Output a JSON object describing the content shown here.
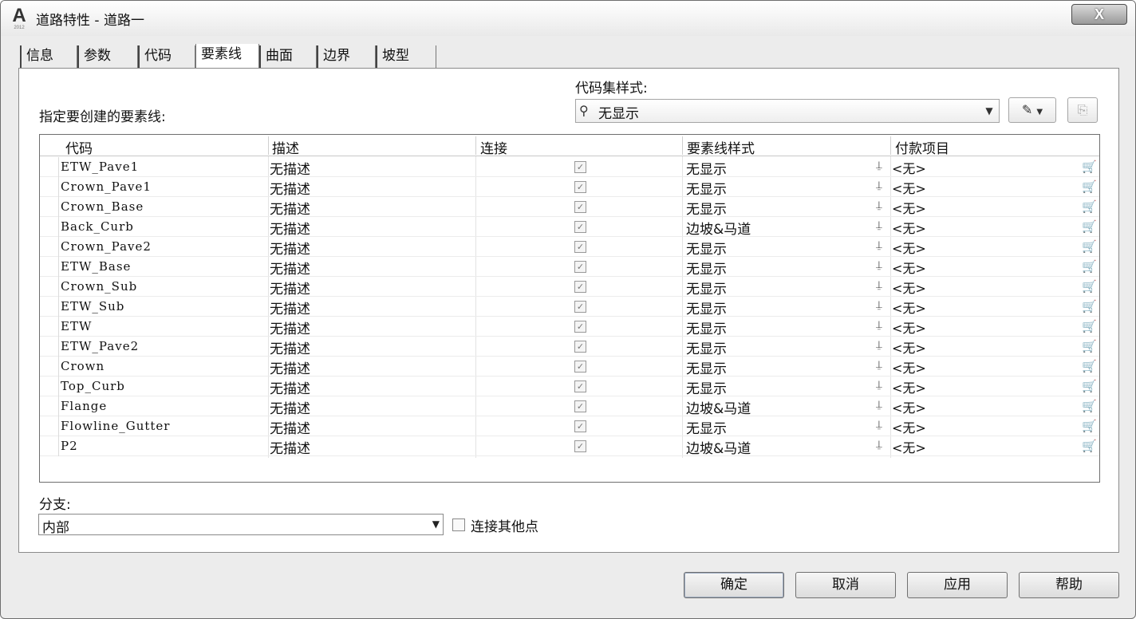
{
  "window": {
    "title": "道路特性 - 道路一",
    "close_label": "X"
  },
  "tabs": [
    {
      "label": "信息",
      "active": false
    },
    {
      "label": "参数",
      "active": false
    },
    {
      "label": "代码",
      "active": false
    },
    {
      "label": "要素线",
      "active": true
    },
    {
      "label": "曲面",
      "active": false
    },
    {
      "label": "边界",
      "active": false
    },
    {
      "label": "坡型",
      "active": false
    }
  ],
  "panel": {
    "instruction": "指定要创建的要素线:",
    "codeset_label": "代码集样式:",
    "codeset_value": "无显示",
    "columns": [
      "代码",
      "描述",
      "连接",
      "要素线样式",
      "付款项目"
    ],
    "rows": [
      {
        "code": "ETW_Pave1",
        "desc": "无描述",
        "connect": true,
        "style": "无显示",
        "pay": "<无>"
      },
      {
        "code": "Crown_Pave1",
        "desc": "无描述",
        "connect": true,
        "style": "无显示",
        "pay": "<无>"
      },
      {
        "code": "Crown_Base",
        "desc": "无描述",
        "connect": true,
        "style": "无显示",
        "pay": "<无>"
      },
      {
        "code": "Back_Curb",
        "desc": "无描述",
        "connect": true,
        "style": "边坡&马道",
        "pay": "<无>"
      },
      {
        "code": "Crown_Pave2",
        "desc": "无描述",
        "connect": true,
        "style": "无显示",
        "pay": "<无>"
      },
      {
        "code": "ETW_Base",
        "desc": "无描述",
        "connect": true,
        "style": "无显示",
        "pay": "<无>"
      },
      {
        "code": "Crown_Sub",
        "desc": "无描述",
        "connect": true,
        "style": "无显示",
        "pay": "<无>"
      },
      {
        "code": "ETW_Sub",
        "desc": "无描述",
        "connect": true,
        "style": "无显示",
        "pay": "<无>"
      },
      {
        "code": "ETW",
        "desc": "无描述",
        "connect": true,
        "style": "无显示",
        "pay": "<无>"
      },
      {
        "code": "ETW_Pave2",
        "desc": "无描述",
        "connect": true,
        "style": "无显示",
        "pay": "<无>"
      },
      {
        "code": "Crown",
        "desc": "无描述",
        "connect": true,
        "style": "无显示",
        "pay": "<无>"
      },
      {
        "code": "Top_Curb",
        "desc": "无描述",
        "connect": true,
        "style": "无显示",
        "pay": "<无>"
      },
      {
        "code": "Flange",
        "desc": "无描述",
        "connect": true,
        "style": "边坡&马道",
        "pay": "<无>"
      },
      {
        "code": "Flowline_Gutter",
        "desc": "无描述",
        "connect": true,
        "style": "无显示",
        "pay": "<无>"
      },
      {
        "code": "P2",
        "desc": "无描述",
        "connect": true,
        "style": "边坡&马道",
        "pay": "<无>"
      }
    ],
    "branch_label": "分支:",
    "branch_value": "内部",
    "connect_other_label": "连接其他点",
    "connect_other_checked": false
  },
  "buttons": {
    "ok": "确定",
    "cancel": "取消",
    "apply": "应用",
    "help": "帮助"
  },
  "icons": {
    "app": "autocad-a-icon",
    "codeset": "codeset-style-icon",
    "edit": "edit-style-icon",
    "preview": "preview-icon",
    "pay_item": "pay-item-icon",
    "cart": "cart-icon"
  }
}
